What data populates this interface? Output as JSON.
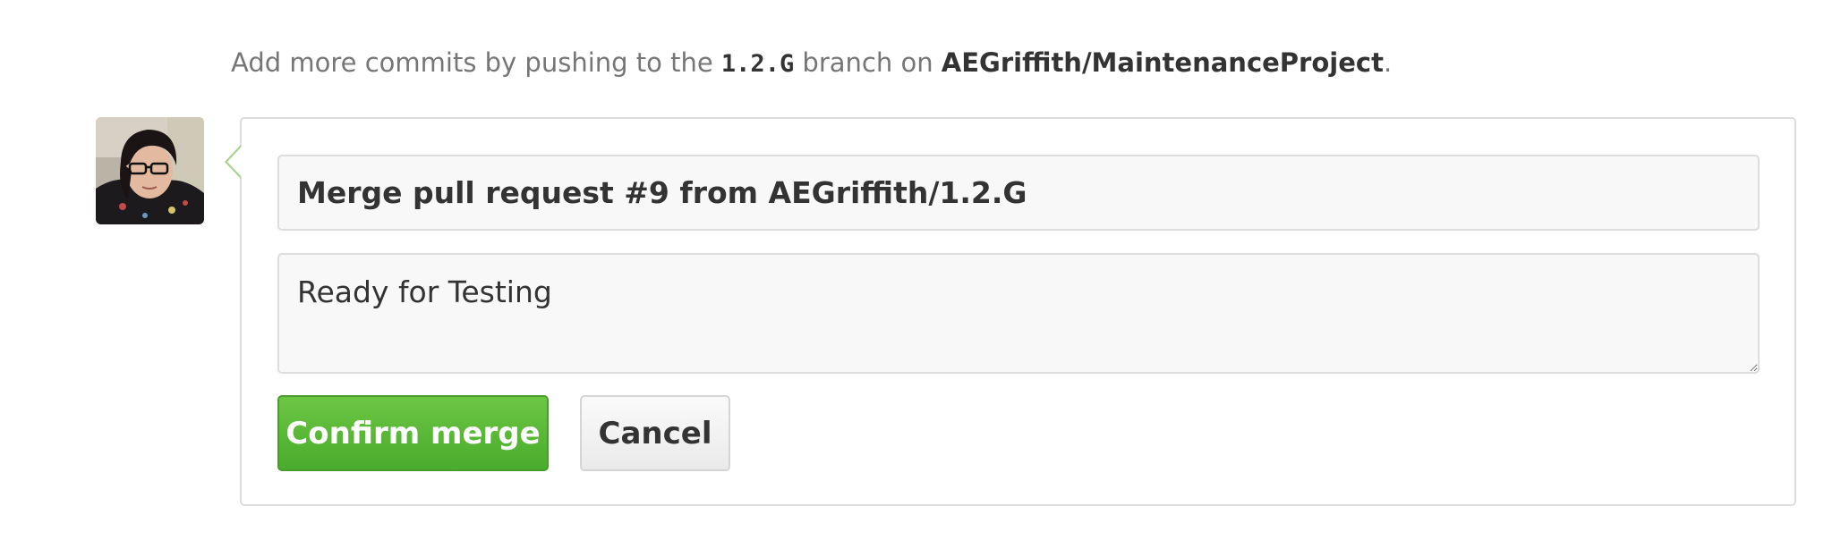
{
  "hint": {
    "prefix": "Add more commits by pushing to the ",
    "branch": "1.2.G",
    "middle": " branch on ",
    "repo": "AEGriffith/MaintenanceProject",
    "suffix": "."
  },
  "avatar": {
    "icon": "user-avatar-photo"
  },
  "merge_form": {
    "title_value": "Merge pull request #9 from AEGriffith/1.2.G",
    "body_value": "Ready for Testing",
    "confirm_label": "Confirm merge",
    "cancel_label": "Cancel"
  },
  "colors": {
    "confirm_green": "#55b934",
    "arrow_green": "#a9d08e"
  }
}
